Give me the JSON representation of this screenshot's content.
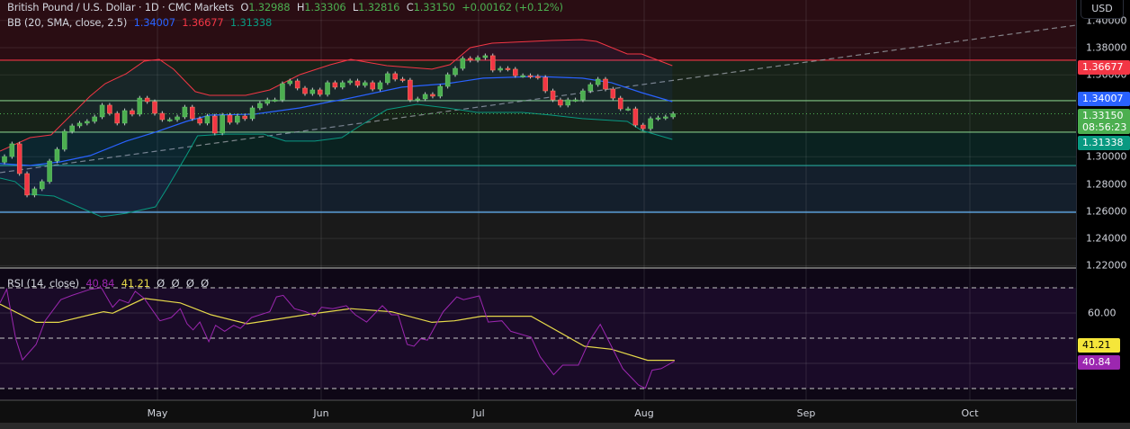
{
  "header": {
    "symbol": "British Pound / U.S. Dollar · 1D · CMC Markets",
    "o_label": "O",
    "o": "1.32988",
    "h_label": "H",
    "h": "1.33306",
    "l_label": "L",
    "l": "1.32816",
    "c_label": "C",
    "c": "1.33150",
    "change": "+0.00162 (+0.12%)"
  },
  "bb_legend": {
    "label": "BB (20, SMA, close, 2.5)",
    "basis": "1.34007",
    "upper": "1.36677",
    "lower": "1.31338"
  },
  "rsi_legend": {
    "label": "RSI (14, close)",
    "rsi": "40.84",
    "ma": "41.21",
    "empty": [
      "Ø",
      "Ø",
      "Ø",
      "Ø"
    ]
  },
  "axis": {
    "currency": "USD",
    "price_ticks": [
      "1.40000",
      "1.38000",
      "1.36000",
      "1.30000",
      "1.28000",
      "1.26000",
      "1.24000",
      "1.22000"
    ],
    "price_tick_values": [
      1.4,
      1.38,
      1.36,
      1.3,
      1.28,
      1.26,
      1.24,
      1.22
    ],
    "tags": {
      "upper": "1.36677",
      "basis": "1.34007",
      "last": "1.33150",
      "countdown": "08:56:23",
      "lower": "1.31338"
    },
    "rsi_ticks": [
      "60.00"
    ],
    "rsi_tags": {
      "ma": "41.21",
      "rsi": "40.84"
    }
  },
  "months": [
    "May",
    "Jun",
    "Jul",
    "Aug",
    "Sep",
    "Oct"
  ],
  "colors": {
    "up": "#4caf50",
    "down": "#f23645",
    "basis": "#2962ff",
    "upper": "#f23645",
    "lower": "#089981",
    "rsi": "#9c27b0",
    "rsi_ma": "#e6d94a"
  },
  "chart_data": {
    "type": "candlestick",
    "first_open": 1.296,
    "closes": [
      1.3001,
      1.3094,
      1.2876,
      1.2718,
      1.2764,
      1.2817,
      1.2968,
      1.3054,
      1.3186,
      1.3226,
      1.3246,
      1.3259,
      1.3292,
      1.3378,
      1.3318,
      1.3246,
      1.3338,
      1.3312,
      1.343,
      1.3404,
      1.3318,
      1.3272,
      1.3272,
      1.3292,
      1.3364,
      1.3279,
      1.3246,
      1.3298,
      1.3173,
      1.3305,
      1.3252,
      1.3298,
      1.3279,
      1.3358,
      1.3391,
      1.3417,
      1.3417,
      1.3536,
      1.3556,
      1.3503,
      1.3463,
      1.349,
      1.3457,
      1.3543,
      1.351,
      1.3543,
      1.3556,
      1.3523,
      1.3543,
      1.3496,
      1.3543,
      1.3609,
      1.3569,
      1.3562,
      1.3417,
      1.3424,
      1.3457,
      1.3444,
      1.3516,
      1.3602,
      1.3648,
      1.3721,
      1.3708,
      1.3727,
      1.3741,
      1.3635,
      1.3648,
      1.3642,
      1.3595,
      1.3595,
      1.3589,
      1.3582,
      1.3483,
      1.3417,
      1.3378,
      1.3417,
      1.3417,
      1.3483,
      1.3529,
      1.3569,
      1.3496,
      1.343,
      1.3351,
      1.3351,
      1.3232,
      1.3206,
      1.3279,
      1.3285,
      1.3292,
      1.3315
    ],
    "bb_upper": [
      [
        -0.6,
        1.3041
      ],
      [
        3.4,
        1.314
      ],
      [
        6.2,
        1.316
      ],
      [
        11.4,
        1.3444
      ],
      [
        13.4,
        1.3536
      ],
      [
        16.2,
        1.3609
      ],
      [
        18.6,
        1.3701
      ],
      [
        20.6,
        1.3714
      ],
      [
        22.5,
        1.3642
      ],
      [
        25.4,
        1.3477
      ],
      [
        27.3,
        1.345
      ],
      [
        32.1,
        1.345
      ],
      [
        35.3,
        1.349
      ],
      [
        39.3,
        1.3602
      ],
      [
        43.4,
        1.3675
      ],
      [
        46.1,
        1.3714
      ],
      [
        50.9,
        1.3668
      ],
      [
        56.9,
        1.3642
      ],
      [
        59.3,
        1.3675
      ],
      [
        62.0,
        1.38
      ],
      [
        64.9,
        1.3833
      ],
      [
        72.8,
        1.3853
      ],
      [
        76.9,
        1.3859
      ],
      [
        78.8,
        1.3846
      ],
      [
        82.9,
        1.3754
      ],
      [
        84.8,
        1.3754
      ],
      [
        88.9,
        1.3668
      ]
    ],
    "bb_basis": [
      [
        -0.6,
        1.2949
      ],
      [
        3.4,
        1.2935
      ],
      [
        7.4,
        1.2962
      ],
      [
        11.4,
        1.3008
      ],
      [
        16.2,
        1.3114
      ],
      [
        20.1,
        1.318
      ],
      [
        24.2,
        1.3259
      ],
      [
        27.3,
        1.3305
      ],
      [
        33.3,
        1.3312
      ],
      [
        39.3,
        1.3358
      ],
      [
        43.4,
        1.3404
      ],
      [
        44.9,
        1.3417
      ],
      [
        52.9,
        1.351
      ],
      [
        58.9,
        1.3536
      ],
      [
        63.7,
        1.3576
      ],
      [
        70.9,
        1.3589
      ],
      [
        76.9,
        1.3576
      ],
      [
        80.8,
        1.3543
      ],
      [
        84.8,
        1.347
      ],
      [
        88.9,
        1.3404
      ]
    ],
    "bb_lower": [
      [
        -0.6,
        1.2843
      ],
      [
        1.4,
        1.2817
      ],
      [
        3.4,
        1.2724
      ],
      [
        6.6,
        1.2711
      ],
      [
        9.3,
        1.2645
      ],
      [
        12.9,
        1.2559
      ],
      [
        16.2,
        1.2585
      ],
      [
        20.1,
        1.2632
      ],
      [
        21.8,
        1.2783
      ],
      [
        24.2,
        1.3008
      ],
      [
        25.7,
        1.3153
      ],
      [
        29.3,
        1.3166
      ],
      [
        34.5,
        1.3166
      ],
      [
        37.4,
        1.3114
      ],
      [
        41.3,
        1.3114
      ],
      [
        44.9,
        1.314
      ],
      [
        47.3,
        1.3226
      ],
      [
        50.9,
        1.3345
      ],
      [
        54.9,
        1.3384
      ],
      [
        58.9,
        1.3358
      ],
      [
        62.9,
        1.3325
      ],
      [
        68.9,
        1.3325
      ],
      [
        72.8,
        1.3305
      ],
      [
        76.9,
        1.3279
      ],
      [
        82.9,
        1.3259
      ],
      [
        84.8,
        1.3193
      ],
      [
        88.9,
        1.3127
      ]
    ],
    "levels": [
      {
        "price": 1.3708,
        "color": "#f23645"
      },
      {
        "price": 1.3411,
        "color": "#81c784"
      },
      {
        "price": 1.318,
        "color": "#81c784"
      },
      {
        "price": 1.2935,
        "color": "#26a69a"
      },
      {
        "price": 1.2592,
        "color": "#64b5f6"
      }
    ],
    "trendline": [
      [
        -0.6,
        1.2883
      ],
      [
        142.5,
        1.3964
      ]
    ],
    "rsi": [
      [
        -0.6,
        64
      ],
      [
        0.3,
        69.4
      ],
      [
        1.5,
        49.8
      ],
      [
        2.4,
        41.4
      ],
      [
        4.2,
        47.5
      ],
      [
        5.4,
        56.9
      ],
      [
        7.5,
        65.3
      ],
      [
        9,
        67
      ],
      [
        11.4,
        69.4
      ],
      [
        12.9,
        70
      ],
      [
        14.4,
        62.3
      ],
      [
        15.3,
        65.3
      ],
      [
        16.5,
        64
      ],
      [
        17.4,
        68.6
      ],
      [
        18.6,
        65.8
      ],
      [
        20.7,
        56.9
      ],
      [
        22.2,
        58.2
      ],
      [
        23.4,
        61.7
      ],
      [
        24.3,
        55.7
      ],
      [
        25.1,
        53.3
      ],
      [
        26,
        56.4
      ],
      [
        27.2,
        48.6
      ],
      [
        28.1,
        55.1
      ],
      [
        29.3,
        52.7
      ],
      [
        30.5,
        55.1
      ],
      [
        31.4,
        53.9
      ],
      [
        32.9,
        58.2
      ],
      [
        35.3,
        60.5
      ],
      [
        36.2,
        66.4
      ],
      [
        37.1,
        67
      ],
      [
        38.6,
        61.7
      ],
      [
        40.1,
        60.5
      ],
      [
        41.3,
        58.7
      ],
      [
        42.2,
        62.3
      ],
      [
        43.7,
        61.7
      ],
      [
        45.5,
        62.9
      ],
      [
        46.7,
        59.3
      ],
      [
        48.2,
        56.4
      ],
      [
        50.3,
        62.9
      ],
      [
        51.5,
        59.3
      ],
      [
        52.4,
        59.3
      ],
      [
        53.6,
        47.5
      ],
      [
        54.5,
        46.8
      ],
      [
        55.4,
        49.8
      ],
      [
        56.3,
        49.2
      ],
      [
        58.4,
        60.5
      ],
      [
        60.2,
        66.4
      ],
      [
        61.1,
        65.3
      ],
      [
        63.2,
        66.8
      ],
      [
        64.4,
        56.4
      ],
      [
        66.2,
        56.9
      ],
      [
        67.4,
        52.7
      ],
      [
        70.1,
        50.4
      ],
      [
        71.3,
        42.6
      ],
      [
        73.1,
        35.5
      ],
      [
        74.3,
        39.3
      ],
      [
        76.4,
        39.3
      ],
      [
        77.8,
        48.6
      ],
      [
        79.3,
        55.5
      ],
      [
        82.3,
        37.9
      ],
      [
        84.4,
        31.4
      ],
      [
        85.3,
        30.1
      ],
      [
        86.2,
        37.3
      ],
      [
        87.4,
        37.9
      ],
      [
        89.2,
        40.84
      ]
    ],
    "rsi_ma": [
      [
        -0.6,
        63.5
      ],
      [
        4.2,
        56.3
      ],
      [
        7.2,
        56.3
      ],
      [
        11.4,
        59.3
      ],
      [
        13.2,
        60.5
      ],
      [
        14.4,
        59.9
      ],
      [
        18.6,
        65.8
      ],
      [
        23.4,
        64
      ],
      [
        27.5,
        59.3
      ],
      [
        32.3,
        55.7
      ],
      [
        40.1,
        59.3
      ],
      [
        46.1,
        61.7
      ],
      [
        51.5,
        60.5
      ],
      [
        56.9,
        56.3
      ],
      [
        59.9,
        56.9
      ],
      [
        63.5,
        58.7
      ],
      [
        70.1,
        58.7
      ],
      [
        77.2,
        46.8
      ],
      [
        80.8,
        45.6
      ],
      [
        85.6,
        41.2
      ],
      [
        89.2,
        41.21
      ]
    ],
    "rsi_levels": [
      70,
      60,
      50,
      40,
      30
    ]
  }
}
